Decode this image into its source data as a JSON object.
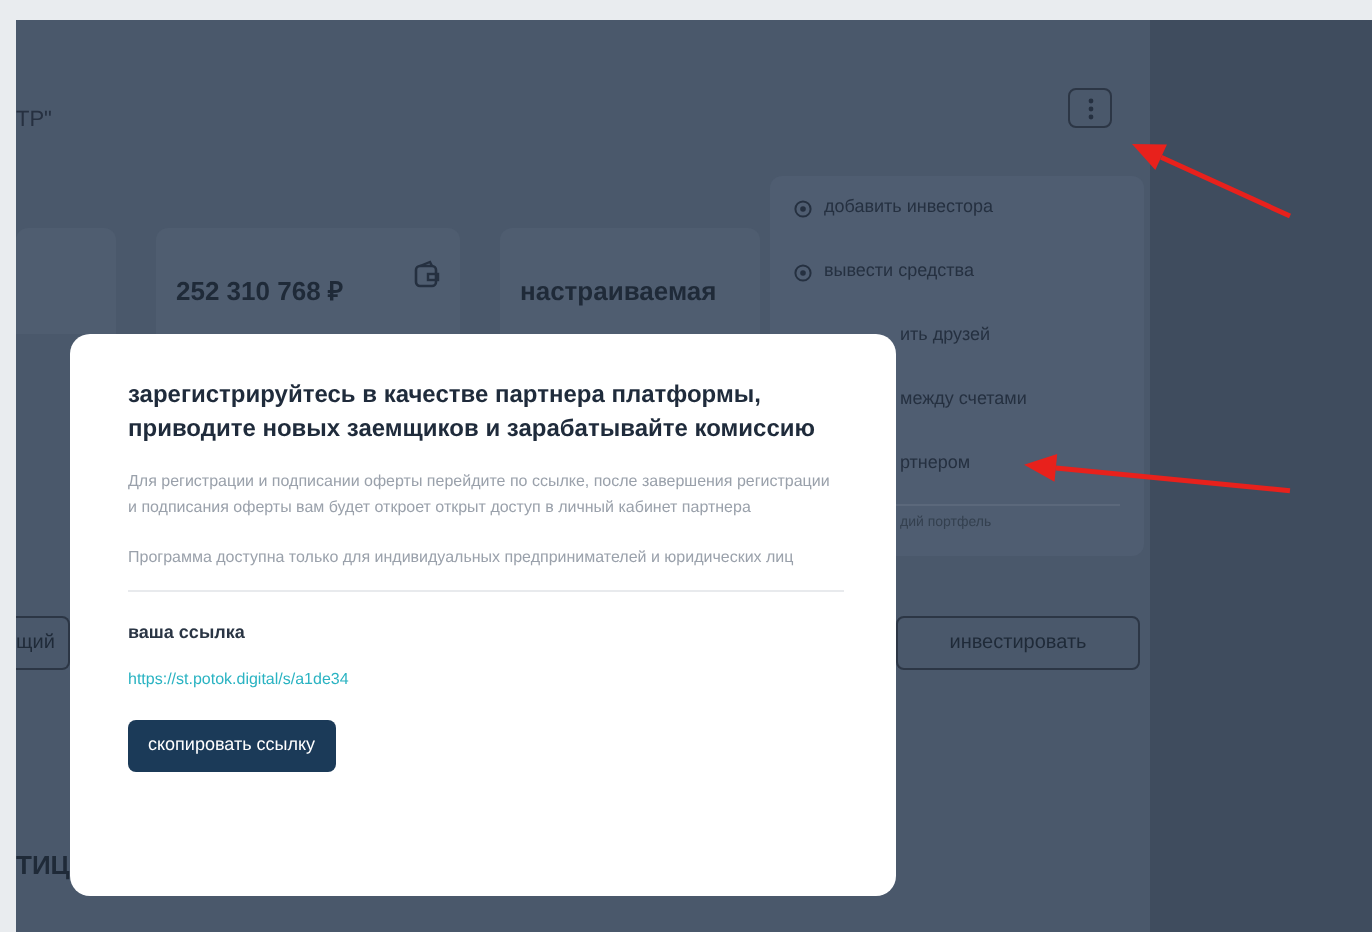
{
  "header": {
    "title": "ТР\""
  },
  "cards": [
    {
      "icon": false
    },
    {
      "value": "252 310 768 ₽",
      "icon": true
    },
    {
      "value": "настраиваемая",
      "icon": false
    }
  ],
  "buttons": [
    {
      "label": "щий"
    },
    {
      "label": "инвестировать"
    }
  ],
  "section_heading": "ТИЦ",
  "menu": {
    "items": [
      {
        "label": "добавить инвестора",
        "icon": true
      },
      {
        "label": "вывести средства",
        "icon": true
      },
      {
        "label": "ить друзей",
        "icon": false
      },
      {
        "label": "между счетами",
        "icon": false
      },
      {
        "label": "ртнером",
        "icon": false
      }
    ],
    "note": "дий портфель"
  },
  "modal": {
    "title": "зарегистрируйтесь в качестве партнера платформы, приводите новых заемщиков и зарабатывайте комиссию",
    "paragraphs": [
      "Для регистрации и подписании оферты перейдите по ссылке, после завершения регистрации и подписания оферты вам будет откроет открыт доступ в личный кабинет партнера",
      "Программа доступна только для индивидуальных предпринимателей и юридических лиц"
    ],
    "link_label": "ваша ссылка",
    "link": "https://st.potok.digital/s/a1de34",
    "button": "скопировать ссылку"
  }
}
